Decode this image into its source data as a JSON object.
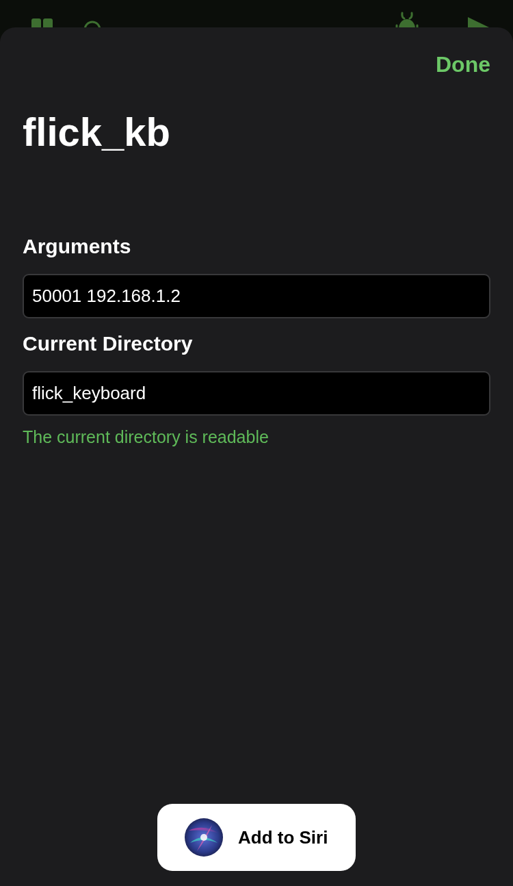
{
  "sheet": {
    "done_button": "Done",
    "title": "flick_kb",
    "fields": [
      {
        "label": "Arguments",
        "value": "50001 192.168.1.2"
      },
      {
        "label": "Current Directory",
        "value": "flick_keyboard"
      }
    ],
    "status": {
      "kind": "success",
      "text": "The current directory is readable"
    },
    "siri_button": "Add to Siri"
  }
}
